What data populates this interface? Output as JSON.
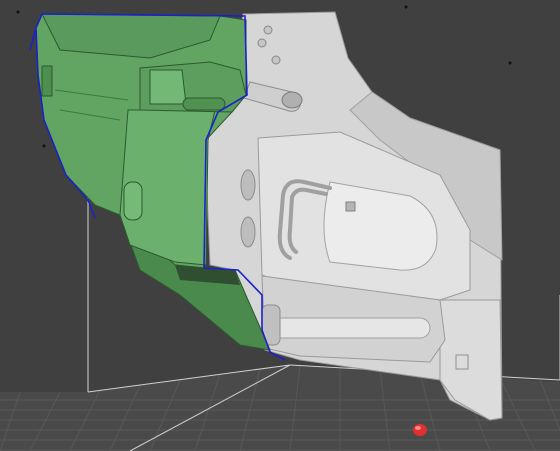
{
  "viewport": {
    "label": "",
    "colors": {
      "background": "#404040",
      "floor": "#4a4a4a",
      "grid_line": "#5c5c5c",
      "bounding_line": "#cfcfcf",
      "selected_part": "#5fa35f",
      "selected_part_dark": "#3f7a42",
      "selection_outline": "#1a22c8",
      "model_surface": "#dadada",
      "model_shadow": "#a9a9a9",
      "pivot_marker": "#e03030"
    },
    "objects": [
      {
        "name": "gun-body-model",
        "type": "mesh"
      },
      {
        "name": "selected-green-part",
        "type": "mesh",
        "selected": true
      },
      {
        "name": "pivot-marker",
        "type": "marker"
      }
    ]
  }
}
